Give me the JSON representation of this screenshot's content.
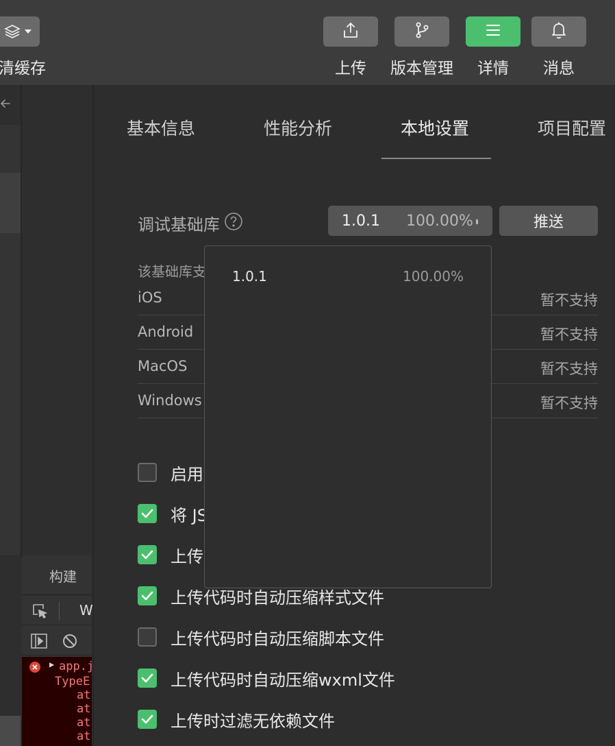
{
  "toolbar": {
    "clear_cache_label": "清缓存",
    "buttons": [
      {
        "label": "上传",
        "icon": "upload-icon"
      },
      {
        "label": "版本管理",
        "icon": "branch-icon"
      },
      {
        "label": "详情",
        "icon": "menu-icon",
        "active": true
      },
      {
        "label": "消息",
        "icon": "bell-icon"
      }
    ],
    "active_color": "#4cbf6e"
  },
  "left_panel": {
    "build_tab": "构建",
    "devtools_tab_partial": "W",
    "console_lines": [
      "app.j",
      "TypeE",
      "at",
      "at",
      "at",
      "at"
    ]
  },
  "tabs": [
    {
      "label": "基本信息"
    },
    {
      "label": "性能分析"
    },
    {
      "label": "本地设置",
      "active": true
    },
    {
      "label": "项目配置"
    }
  ],
  "debug_lib": {
    "label": "调试基础库",
    "selected_version": "1.0.1",
    "selected_pct": "100.00%",
    "push_label": "推送"
  },
  "support": {
    "note": "该基础库支",
    "rows": [
      {
        "os": "iOS",
        "status": "暂不支持"
      },
      {
        "os": "Android",
        "status": "暂不支持"
      },
      {
        "os": "MacOS",
        "status": "暂不支持"
      },
      {
        "os": "Windows",
        "status": "暂不支持"
      }
    ]
  },
  "options": [
    {
      "label": "启用",
      "checked": false
    },
    {
      "label": "将 JS",
      "checked": true
    },
    {
      "label": "上传",
      "checked": true
    },
    {
      "label": "上传代码时自动压缩样式文件",
      "checked": true
    },
    {
      "label": "上传代码时自动压缩脚本文件",
      "checked": false
    },
    {
      "label": "上传代码时自动压缩wxml文件",
      "checked": true
    },
    {
      "label": "上传时过滤无依赖文件",
      "checked": true
    }
  ],
  "dropdown": {
    "options": [
      {
        "version": "1.0.1",
        "pct": "100.00%"
      }
    ]
  }
}
